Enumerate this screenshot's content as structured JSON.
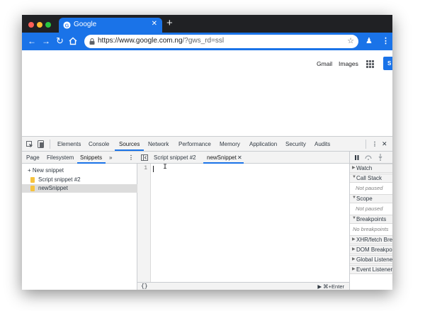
{
  "browser": {
    "tab_title": "Google",
    "url_host": "https://www.google.com.ng",
    "url_rest": "/?gws_rd=ssl",
    "close_glyph": "✕",
    "new_tab_glyph": "+",
    "colors": {
      "tabbar": "#202124",
      "toolbar": "#1a73e8",
      "close": "#ff5f57",
      "minimize": "#febc2e",
      "maximize": "#28c840"
    }
  },
  "page": {
    "links": [
      "Gmail",
      "Images"
    ],
    "signin_label": "S"
  },
  "devtools": {
    "panels": [
      "Elements",
      "Console",
      "Sources",
      "Network",
      "Performance",
      "Memory",
      "Application",
      "Security",
      "Audits"
    ],
    "active_panel": "Sources",
    "navigator_tabs": [
      "Page",
      "Filesystem",
      "Snippets"
    ],
    "active_navigator_tab": "Snippets",
    "more_glyph": "»",
    "new_snippet_label": "+ New snippet",
    "snippets": [
      {
        "name": "Script snippet #2",
        "selected": false
      },
      {
        "name": "newSnippet",
        "selected": true
      }
    ],
    "editor_tabs": [
      {
        "name": "Script snippet #2",
        "active": false
      },
      {
        "name": "newSnippet",
        "active": true
      }
    ],
    "line_number": "1",
    "format_label": "{}",
    "run_label": "▶ ⌘+Enter",
    "debugger_sections": [
      {
        "title": "Watch",
        "expanded": false,
        "placeholder": ""
      },
      {
        "title": "Call Stack",
        "expanded": true,
        "placeholder": "Not paused"
      },
      {
        "title": "Scope",
        "expanded": true,
        "placeholder": "Not paused"
      },
      {
        "title": "Breakpoints",
        "expanded": true,
        "placeholder": "No breakpoints"
      },
      {
        "title": "XHR/fetch Breakpoints",
        "expanded": false,
        "placeholder": ""
      },
      {
        "title": "DOM Breakpoints",
        "expanded": false,
        "placeholder": ""
      },
      {
        "title": "Global Listeners",
        "expanded": false,
        "placeholder": ""
      },
      {
        "title": "Event Listener Breakpoints",
        "expanded": false,
        "placeholder": ""
      }
    ]
  }
}
